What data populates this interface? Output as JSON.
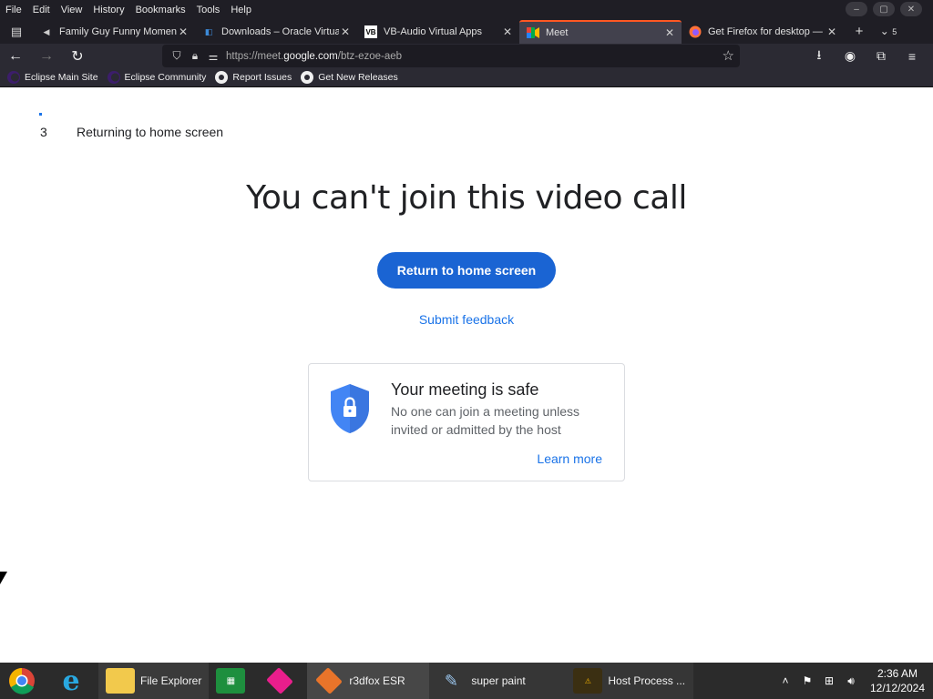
{
  "menubar": {
    "items": [
      "File",
      "Edit",
      "View",
      "History",
      "Bookmarks",
      "Tools",
      "Help"
    ]
  },
  "tabs": [
    {
      "label": "Family Guy Funny Moment",
      "icon": "speaker-icon"
    },
    {
      "label": "Downloads – Oracle Virtual",
      "icon": "virtualbox-icon"
    },
    {
      "label": "VB-Audio Virtual Apps",
      "icon": "vb-icon",
      "icon_text": "VB"
    },
    {
      "label": "Meet",
      "icon": "google-meet-icon",
      "active": true
    },
    {
      "label": "Get Firefox for desktop — I",
      "icon": "firefox-icon"
    }
  ],
  "tab_count_overflow": "5",
  "address": {
    "prefix": "https://meet.",
    "domain": "google.com",
    "path": "/btz-ezoe-aeb"
  },
  "bookmarks": [
    {
      "label": "Eclipse Main Site",
      "icon": "eclipse-icon"
    },
    {
      "label": "Eclipse Community",
      "icon": "eclipse-icon"
    },
    {
      "label": "Report Issues",
      "icon": "github-icon"
    },
    {
      "label": "Get New Releases",
      "icon": "github-icon"
    }
  ],
  "page": {
    "countdown_number": "3",
    "countdown_text": "Returning to home screen",
    "heading": "You can't join this video call",
    "primary_button": "Return to home screen",
    "feedback_link": "Submit feedback",
    "safe_card": {
      "title": "Your meeting is safe",
      "description": "No one can join a meeting unless invited or admitted by the host",
      "link": "Learn more"
    }
  },
  "taskbar": {
    "items": [
      {
        "label": "",
        "icon": "chrome-icon"
      },
      {
        "label": "",
        "icon": "internet-explorer-icon"
      },
      {
        "label": "File Explorer",
        "icon": "folder-icon"
      },
      {
        "label": "",
        "icon": "store-icon"
      },
      {
        "label": "",
        "icon": "pink-app-icon"
      },
      {
        "label": "r3dfox ESR",
        "icon": "r3dfox-icon",
        "active": true
      },
      {
        "label": "super paint",
        "icon": "paint-icon"
      },
      {
        "label": "Host Process ...",
        "icon": "warning-app-icon"
      }
    ],
    "time": "2:36 AM",
    "date": "12/12/2024"
  },
  "colors": {
    "primary": "#1a64d3",
    "link": "#1a73e8",
    "tab_accent": "#ff5722",
    "chrome_dark": "#2b2a33"
  }
}
